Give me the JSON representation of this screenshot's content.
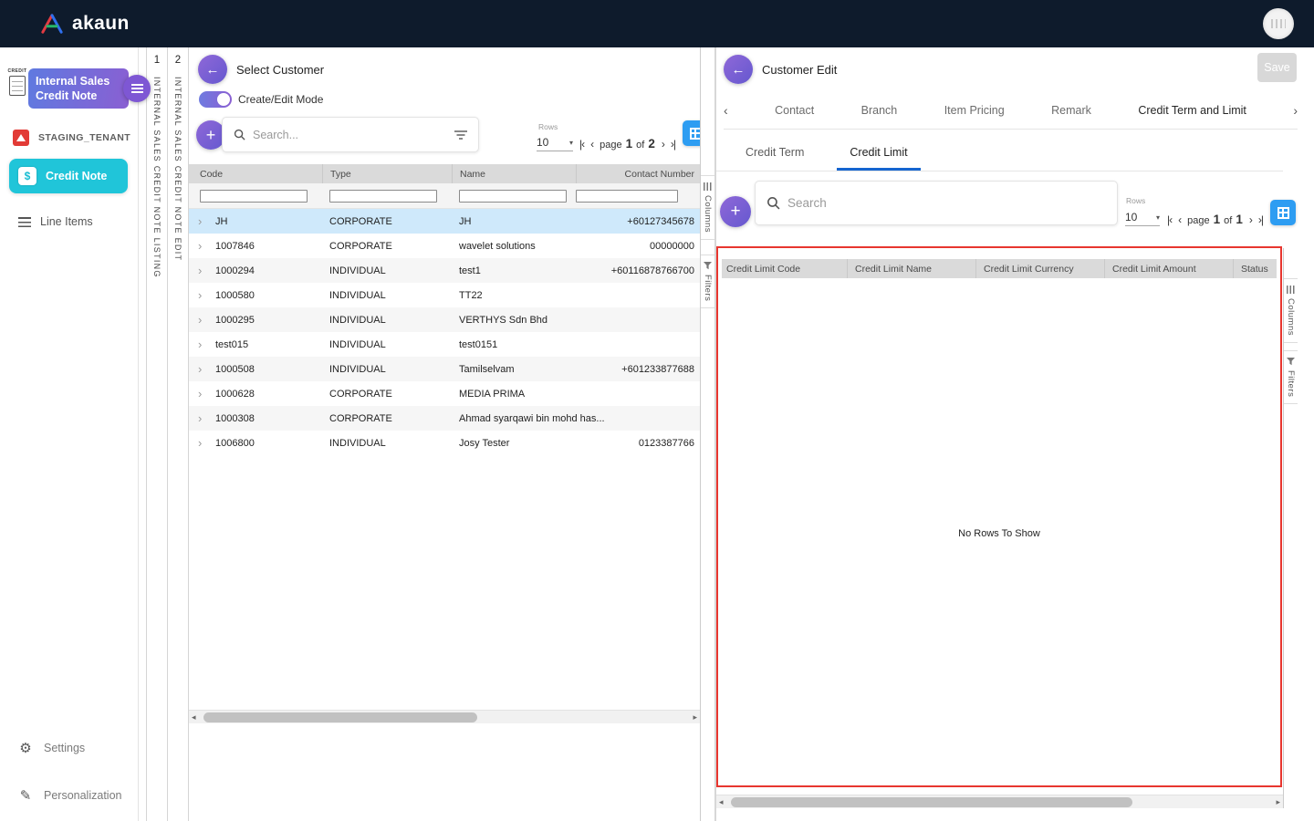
{
  "topbar": {
    "brand": "akaun"
  },
  "sidebar": {
    "module": {
      "label": "Internal Sales Credit Note",
      "icon_label": "CREDIT"
    },
    "tenant": {
      "label": "STAGING_TENANT"
    },
    "nav": [
      {
        "label": "Credit Note"
      },
      {
        "label": "Line Items"
      }
    ],
    "footer": [
      {
        "label": "Settings"
      },
      {
        "label": "Personalization"
      }
    ]
  },
  "vertical_tabs": [
    {
      "index": "1",
      "label": "INTERNAL SALES CREDIT NOTE LISTING"
    },
    {
      "index": "2",
      "label": "INTERNAL SALES CREDIT NOTE EDIT"
    }
  ],
  "customer_panel": {
    "title": "Select Customer",
    "mode_toggle_label": "Create/Edit Mode",
    "search_placeholder": "Search...",
    "rows_label": "Rows",
    "rows_per_page": "10",
    "pagination": {
      "page_label": "page",
      "current": "1",
      "of_label": "of",
      "total": "2"
    },
    "table": {
      "columns": [
        "Code",
        "Type",
        "Name",
        "Contact Number"
      ],
      "rows": [
        {
          "code": "JH",
          "type": "CORPORATE",
          "name": "JH",
          "contact": "+60127345678"
        },
        {
          "code": "1007846",
          "type": "CORPORATE",
          "name": "wavelet solutions",
          "contact": "00000000"
        },
        {
          "code": "1000294",
          "type": "INDIVIDUAL",
          "name": "test1",
          "contact": "+60116878766700"
        },
        {
          "code": "1000580",
          "type": "INDIVIDUAL",
          "name": "TT22",
          "contact": ""
        },
        {
          "code": "1000295",
          "type": "INDIVIDUAL",
          "name": "VERTHYS Sdn Bhd",
          "contact": ""
        },
        {
          "code": "test015",
          "type": "INDIVIDUAL",
          "name": "test0151",
          "contact": ""
        },
        {
          "code": "1000508",
          "type": "INDIVIDUAL",
          "name": "Tamilselvam",
          "contact": "+601233877688"
        },
        {
          "code": "1000628",
          "type": "CORPORATE",
          "name": "MEDIA PRIMA",
          "contact": ""
        },
        {
          "code": "1000308",
          "type": "CORPORATE",
          "name": "Ahmad syarqawi bin mohd has...",
          "contact": ""
        },
        {
          "code": "1006800",
          "type": "INDIVIDUAL",
          "name": "Josy Tester",
          "contact": "0123387766"
        }
      ]
    },
    "rails": {
      "columns": "Columns",
      "filters": "Filters"
    }
  },
  "edit_panel": {
    "title": "Customer Edit",
    "save_label": "Save",
    "tabs": [
      "Contact",
      "Branch",
      "Item Pricing",
      "Remark",
      "Credit Term and Limit"
    ],
    "active_tab": "Credit Term and Limit",
    "sub_tabs": [
      "Credit Term",
      "Credit Limit"
    ],
    "active_sub_tab": "Credit Limit",
    "search_placeholder": "Search",
    "rows_label": "Rows",
    "rows_per_page": "10",
    "pagination": {
      "page_label": "page",
      "current": "1",
      "of_label": "of",
      "total": "1"
    },
    "table": {
      "columns": [
        "Credit Limit Code",
        "Credit Limit Name",
        "Credit Limit Currency",
        "Credit Limit Amount",
        "Status"
      ],
      "empty_message": "No Rows To Show"
    },
    "rails": {
      "columns": "Columns",
      "filters": "Filters"
    }
  },
  "icons": {
    "back": "←",
    "plus": "+",
    "caret": "▾",
    "first": "|‹",
    "prev": "‹",
    "next": "›",
    "last": "›|",
    "row_chevron": "›",
    "scroll_left": "◂",
    "scroll_right": "▸",
    "tab_prev": "‹",
    "tab_next": "›",
    "gear": "⚙",
    "pen": "✎",
    "credit_note_doc": "$"
  },
  "colors": {
    "topbar": "#0e1b2c",
    "accent_purple": "#7a5cd0",
    "accent_teal": "#20c5d9",
    "selected_row": "#cfe9fb",
    "active_tab_underline": "#1565d0",
    "annotation_red": "#e8362f",
    "grid_button_blue": "#2e9df2"
  }
}
